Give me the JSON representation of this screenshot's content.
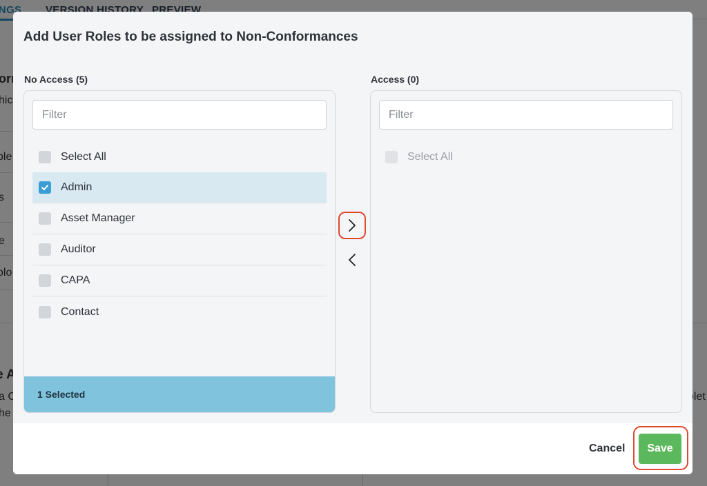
{
  "background": {
    "tabs": [
      "TINGS",
      "VERSION HISTORY",
      "PREVIEW"
    ],
    "fragments": [
      "orm",
      "hic",
      "ble",
      "s",
      "e",
      "olo",
      "e A",
      "a C",
      "he c",
      "plet"
    ]
  },
  "modal": {
    "title": "Add User Roles to be assigned to Non-Conformances",
    "left_panel": {
      "label": "No Access (5)",
      "filter_placeholder": "Filter",
      "select_all_label": "Select All",
      "items": [
        {
          "label": "Admin",
          "checked": true
        },
        {
          "label": "Asset Manager",
          "checked": false
        },
        {
          "label": "Auditor",
          "checked": false
        },
        {
          "label": "CAPA",
          "checked": false
        },
        {
          "label": "Contact",
          "checked": false
        }
      ],
      "selected_count_label": "1 Selected"
    },
    "right_panel": {
      "label": "Access (0)",
      "filter_placeholder": "Filter",
      "select_all_label": "Select All"
    },
    "icons": {
      "move_right": "chevron-right-icon",
      "move_left": "chevron-left-icon",
      "check": "checkmark-icon"
    },
    "buttons": {
      "cancel_label": "Cancel",
      "save_label": "Save"
    }
  },
  "colors": {
    "accent_blue": "#3a9ed4",
    "selected_bar": "#80c3dd",
    "selected_row": "#d9e9f2",
    "save_green": "#5cb85c",
    "highlight_red": "#e0492f"
  }
}
